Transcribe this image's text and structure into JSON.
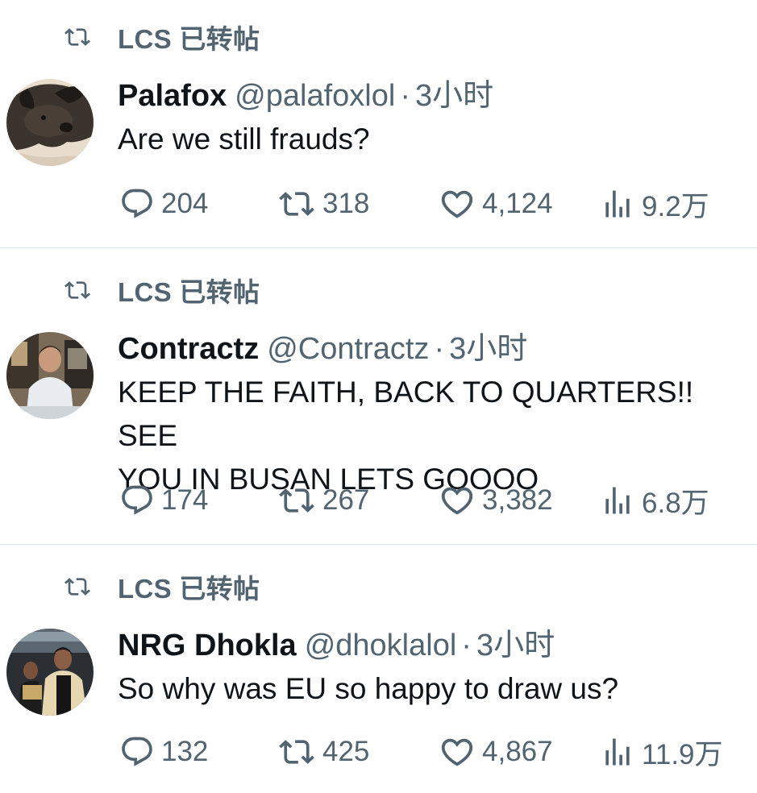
{
  "tweets": [
    {
      "retweeted_by": "LCS 已转帖",
      "display_name": "Palafox",
      "handle": "@palafoxlol",
      "separator": "·",
      "time": "3小时",
      "text": "Are we still frauds?",
      "avatar_icon": "dog-avatar",
      "stats": {
        "replies": "204",
        "reposts": "318",
        "likes": "4,124",
        "views": "9.2万"
      }
    },
    {
      "retweeted_by": "LCS 已转帖",
      "display_name": "Contractz",
      "handle": "@Contractz",
      "separator": "·",
      "time": "3小时",
      "text": "KEEP THE FAITH, BACK TO QUARTERS!! SEE\nYOU IN BUSAN LETS GOOOO",
      "avatar_icon": "person-avatar",
      "stats": {
        "replies": "174",
        "reposts": "267",
        "likes": "3,382",
        "views": "6.8万"
      }
    },
    {
      "retweeted_by": "LCS 已转帖",
      "display_name": "NRG Dhokla",
      "handle": "@dhoklalol",
      "separator": "·",
      "time": "3小时",
      "text": "So why was EU so happy to draw us?",
      "avatar_icon": "team-avatar",
      "stats": {
        "replies": "132",
        "reposts": "425",
        "likes": "4,867",
        "views": "11.9万"
      }
    }
  ],
  "colors": {
    "text_primary": "#0f1419",
    "text_secondary": "#536471",
    "divider": "#e1e6ea",
    "background": "#ffffff"
  }
}
